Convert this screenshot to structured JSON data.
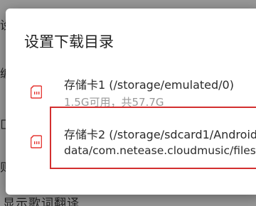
{
  "background": {
    "side_glyphs": [
      "设",
      "编",
      "匚",
      "则"
    ],
    "bottom_text": "显示歌词翻译"
  },
  "dialog": {
    "title": "设置下载目录",
    "items": [
      {
        "icon": "sd-card-icon",
        "title": "存储卡1 (/storage/emulated/0)",
        "subtitle": "1.5G可用，共57.7G"
      },
      {
        "icon": "sd-card-icon",
        "title": "存储卡2 (/storage/sdcard1/Android/",
        "subtitle": "data/com.netease.cloudmusic/files)"
      }
    ]
  },
  "colors": {
    "accent": "#e53935",
    "highlight_border": "#d32f2f",
    "subtitle": "#9a9a9a"
  }
}
